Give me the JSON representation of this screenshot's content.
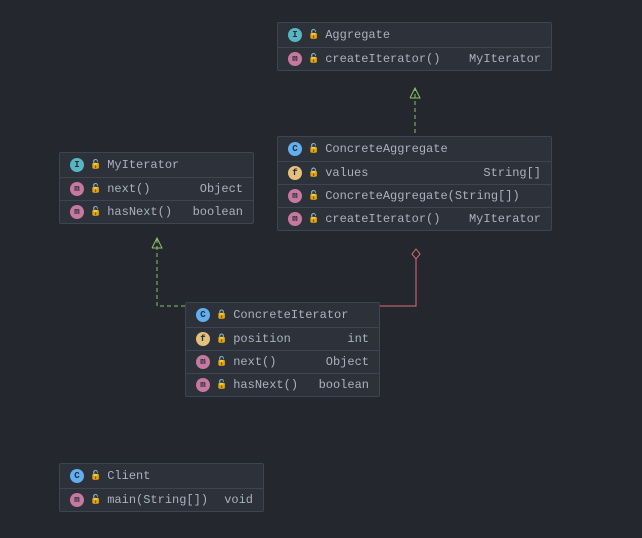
{
  "diagram": {
    "aggregate": {
      "name": "Aggregate",
      "kind": "interface",
      "members": [
        {
          "icon": "m",
          "vis": "unlock",
          "sig": "createIterator()",
          "ret": "MyIterator"
        }
      ]
    },
    "myIterator": {
      "name": "MyIterator",
      "kind": "interface",
      "members": [
        {
          "icon": "m",
          "vis": "unlock",
          "sig": "next()",
          "ret": "Object"
        },
        {
          "icon": "m",
          "vis": "unlock",
          "sig": "hasNext()",
          "ret": "boolean"
        }
      ]
    },
    "concreteAggregate": {
      "name": "ConcreteAggregate",
      "kind": "class",
      "members": [
        {
          "icon": "f",
          "vis": "lock",
          "sig": "values",
          "ret": "String[]"
        },
        {
          "icon": "m",
          "vis": "unlock",
          "sig": "ConcreteAggregate(String[])",
          "ret": ""
        },
        {
          "icon": "m",
          "vis": "unlock",
          "sig": "createIterator()",
          "ret": "MyIterator"
        }
      ]
    },
    "concreteIterator": {
      "name": "ConcreteIterator",
      "kind": "class-lock",
      "members": [
        {
          "icon": "f",
          "vis": "lock",
          "sig": "position",
          "ret": "int"
        },
        {
          "icon": "m",
          "vis": "unlock",
          "sig": "next()",
          "ret": "Object"
        },
        {
          "icon": "m",
          "vis": "unlock",
          "sig": "hasNext()",
          "ret": "boolean"
        }
      ]
    },
    "client": {
      "name": "Client",
      "kind": "class-runnable",
      "members": [
        {
          "icon": "m",
          "vis": "unlock",
          "sig": "main(String[])",
          "ret": "void"
        }
      ]
    }
  },
  "icons": {
    "lock": "🔒",
    "unlock": "🔓"
  }
}
